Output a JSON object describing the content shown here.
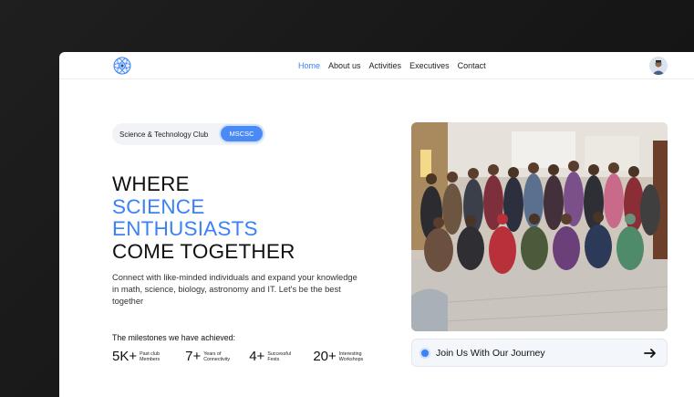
{
  "nav": {
    "links": [
      "Home",
      "About us",
      "Activities",
      "Executives",
      "Contact"
    ],
    "active": "Home",
    "logo_icon": "club-logo-icon",
    "avatar_icon": "user-avatar"
  },
  "hero": {
    "pill_text": "Science & Technology Club",
    "pill_badge": "MSCSC",
    "headline_line1": "WHERE",
    "headline_line2": "SCIENCE",
    "headline_line3": "ENTHUSIASTS",
    "headline_line4": "COME TOGETHER",
    "description": "Connect with like-minded individuals and expand your knowledge in math, science, biology, astronomy and IT. Let's be the best together"
  },
  "milestones": {
    "title": "The milestones we have achieved:",
    "items": [
      {
        "value": "5K+",
        "label": "Past club Members"
      },
      {
        "value": "7+",
        "label": "Years of Connectivity"
      },
      {
        "value": "4+",
        "label": "Successful Fests"
      },
      {
        "value": "20+",
        "label": "Interesting Workshops"
      }
    ]
  },
  "cta": {
    "label": "Join Us With Our Journey",
    "arrow_icon": "arrow-right-icon"
  },
  "colors": {
    "accent": "#3b82f6",
    "background": "#1a1a1a",
    "card": "#ffffff"
  }
}
